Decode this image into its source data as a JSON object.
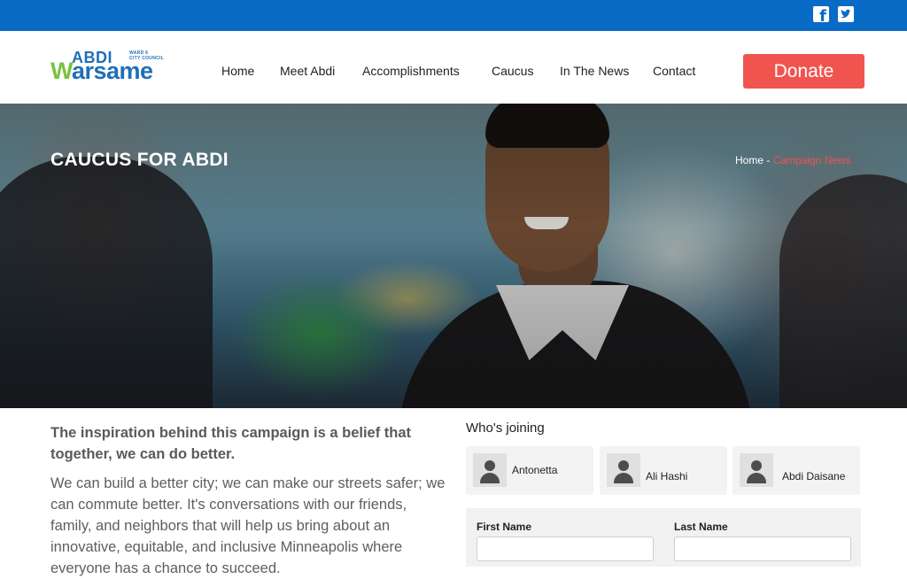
{
  "social": {
    "facebook_icon": "facebook-icon",
    "twitter_icon": "twitter-icon",
    "bar_color": "#0a6bc7"
  },
  "logo": {
    "top_text": "ABDI",
    "main_text": "arsame",
    "main_initial": "W",
    "ward": "WARD 6",
    "council": "CITY COUNCIL"
  },
  "nav": {
    "items": [
      "Home",
      "Meet Abdi",
      "Accomplishments",
      "Caucus",
      "In The News",
      "Contact"
    ]
  },
  "donate": {
    "label": "Donate",
    "color": "#f0544f"
  },
  "hero": {
    "title": "CAUCUS FOR ABDI",
    "breadcrumb": {
      "home": "Home",
      "separator": " - ",
      "current": "Campaign News"
    }
  },
  "content": {
    "lead": "The inspiration behind this campaign is a belief that together, we can do better.",
    "body": "We can build a better city; we can make our streets safer; we can commute better. It's conversations with our friends, family, and neighbors that will help us bring about an innovative, equitable, and inclusive Minneapolis where everyone has a chance to succeed."
  },
  "joining": {
    "title": "Who's joining",
    "people": [
      "Antonetta",
      "Ali Hashi",
      "Abdi Daisane"
    ]
  },
  "form": {
    "first_name_label": "First Name",
    "last_name_label": "Last Name",
    "first_name_value": "",
    "last_name_value": ""
  }
}
